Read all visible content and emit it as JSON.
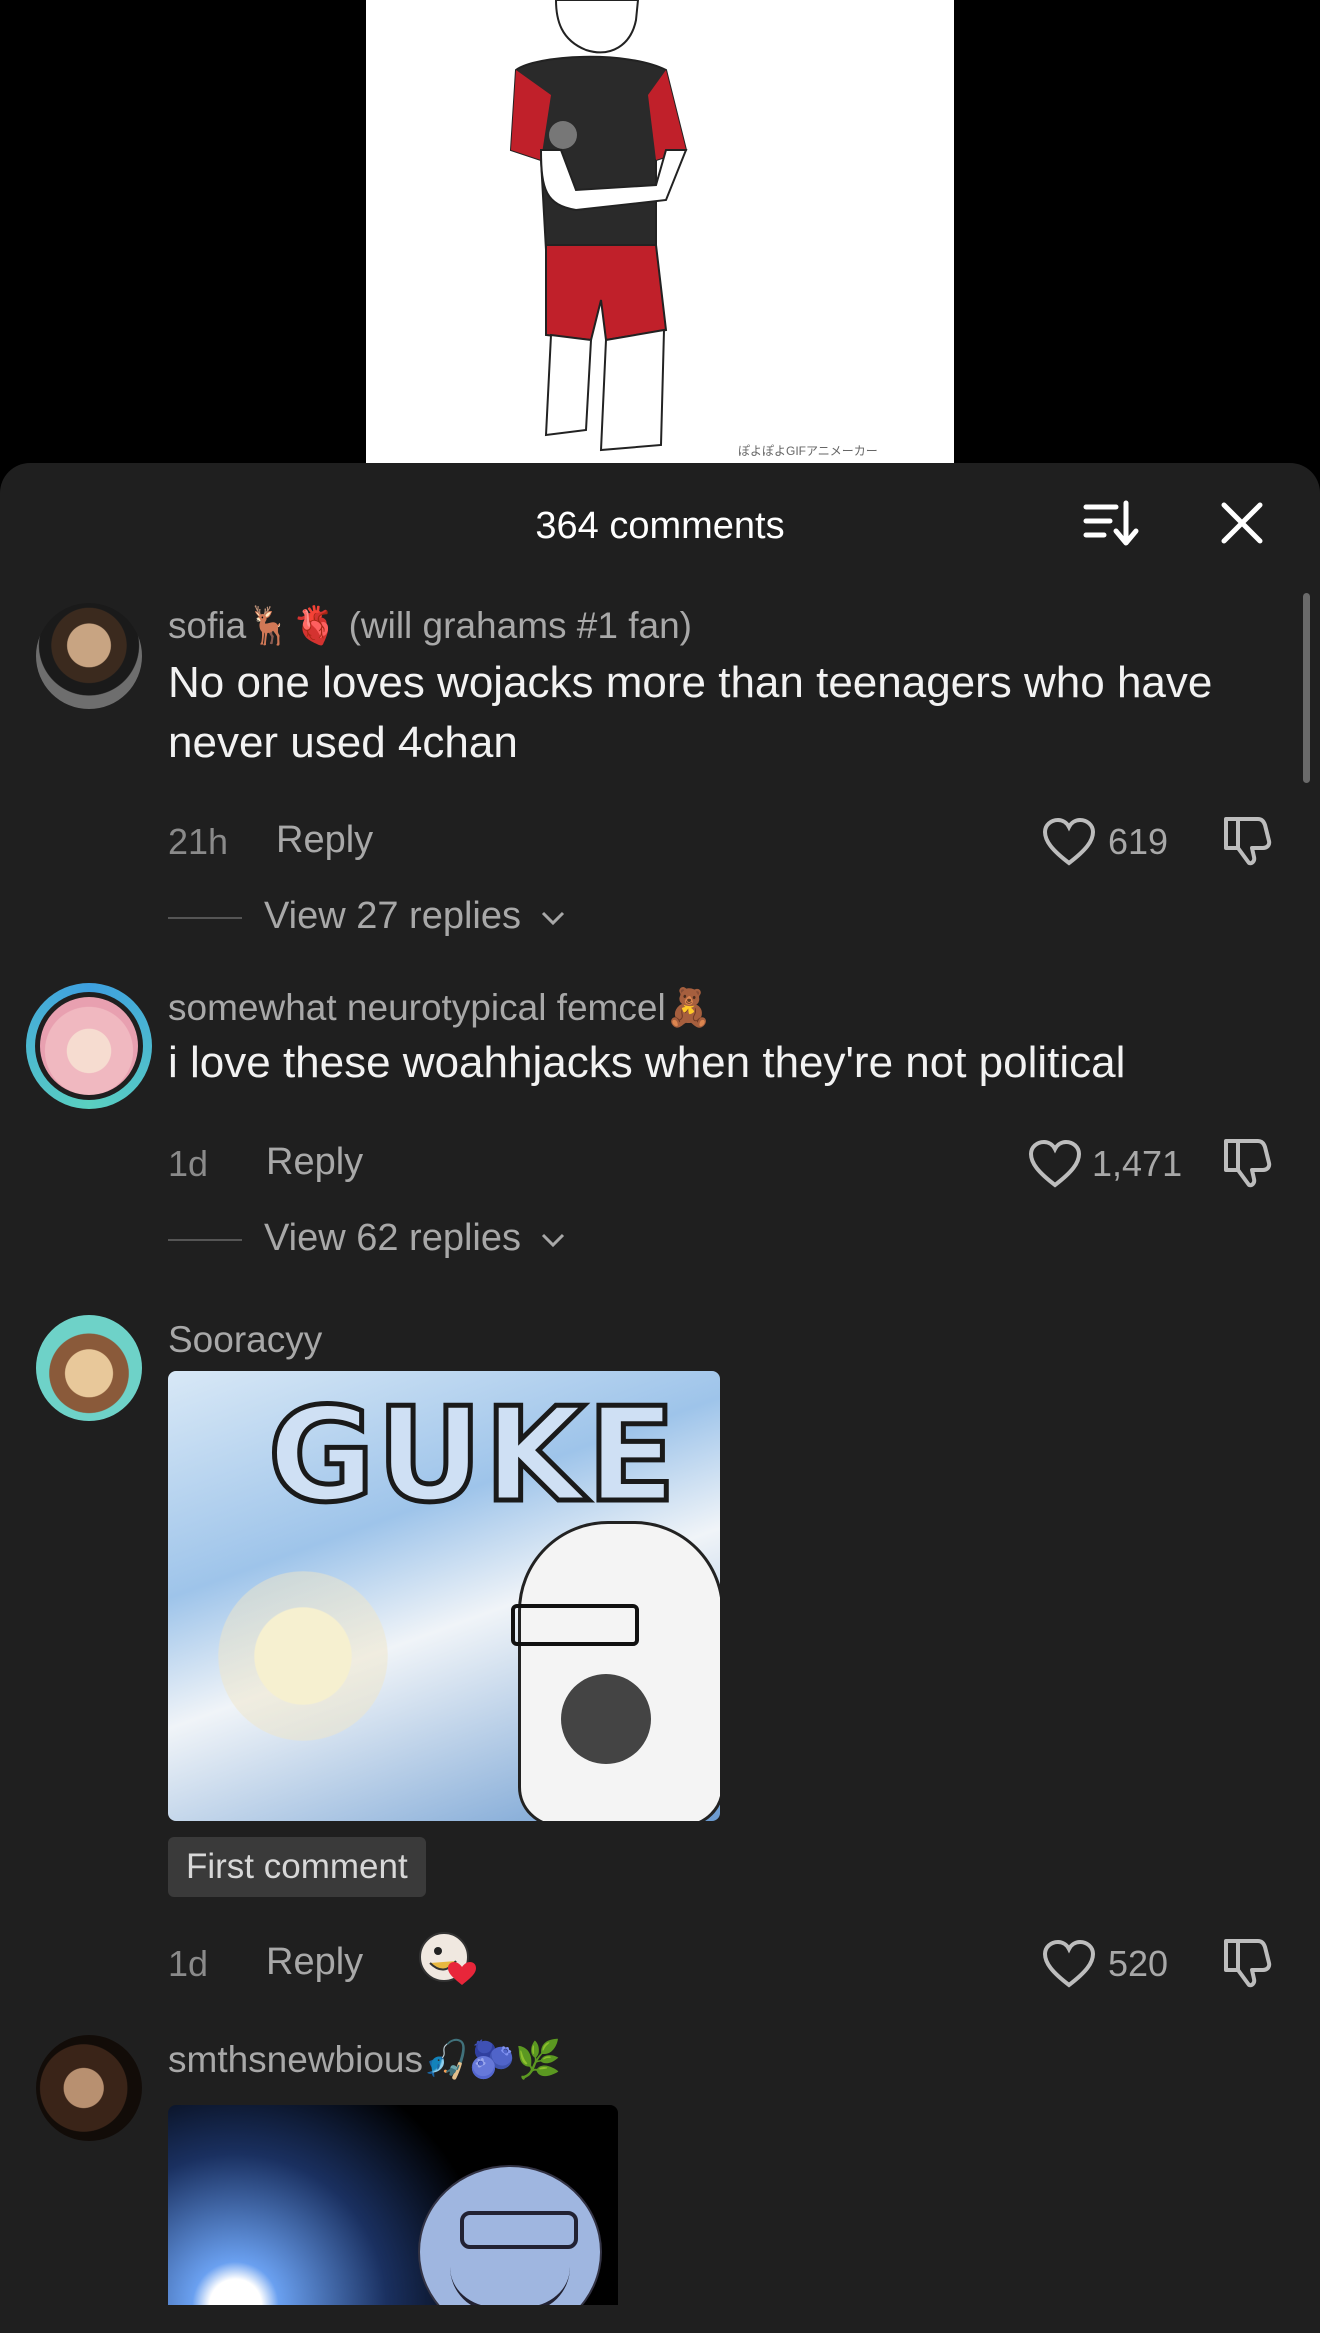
{
  "video": {
    "caption": "ぽよぽよGIFアニメーカー"
  },
  "sheet": {
    "title": "364 comments",
    "sort_icon": "sort-icon",
    "close_icon": "close-icon"
  },
  "comments": [
    {
      "username": "sofia🦌🫀 (will grahams #1 fan)",
      "text": "No one loves wojacks more than teenagers who have never used 4chan",
      "time": "21h",
      "reply_label": "Reply",
      "likes": "619",
      "view_replies": "View 27 replies"
    },
    {
      "username": "somewhat neurotypical femcel🧸",
      "text": "i love these woahhjacks when they're not political",
      "time": "1d",
      "reply_label": "Reply",
      "likes": "1,471",
      "view_replies": "View 62 replies"
    },
    {
      "username": "Sooracyy",
      "image_text": "GUKE",
      "badge": "First comment",
      "time": "1d",
      "reply_label": "Reply",
      "likes": "520"
    },
    {
      "username": "smthsnewbious🎣🫐🌿"
    }
  ],
  "colors": {
    "sheet_bg": "#1f1f1f",
    "text_primary": "#f2f2f2",
    "text_secondary": "#a8a8a8",
    "story_ring": "#3ea0e0"
  }
}
